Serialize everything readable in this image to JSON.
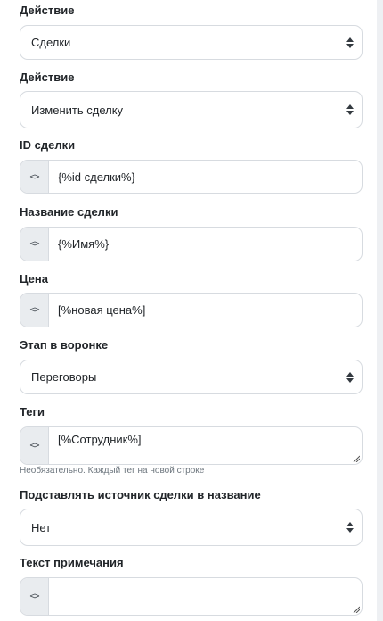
{
  "fields": {
    "action1": {
      "label": "Действие",
      "value": "Сделки"
    },
    "action2": {
      "label": "Действие",
      "value": "Изменить сделку"
    },
    "deal_id": {
      "label": "ID сделки",
      "value": "{%id сделки%}",
      "addon": "<>"
    },
    "deal_name": {
      "label": "Название сделки",
      "value": "{%Имя%}",
      "addon": "<>"
    },
    "price": {
      "label": "Цена",
      "value": "[%новая цена%]",
      "addon": "<>"
    },
    "stage": {
      "label": "Этап в воронке",
      "value": "Переговоры"
    },
    "tags": {
      "label": "Теги",
      "value": "[%Сотрудник%]",
      "addon": "<>",
      "hint": "Необязательно. Каждый тег на новой строке"
    },
    "source_in_name": {
      "label": "Подставлять источник сделки в название",
      "value": "Нет"
    },
    "note_text": {
      "label": "Текст примечания",
      "value": "",
      "addon": "<>"
    }
  },
  "icons": {
    "select_caret": "sort-caret-icon",
    "code_addon": "code-brackets-icon",
    "resize": "resize-grip-icon"
  }
}
